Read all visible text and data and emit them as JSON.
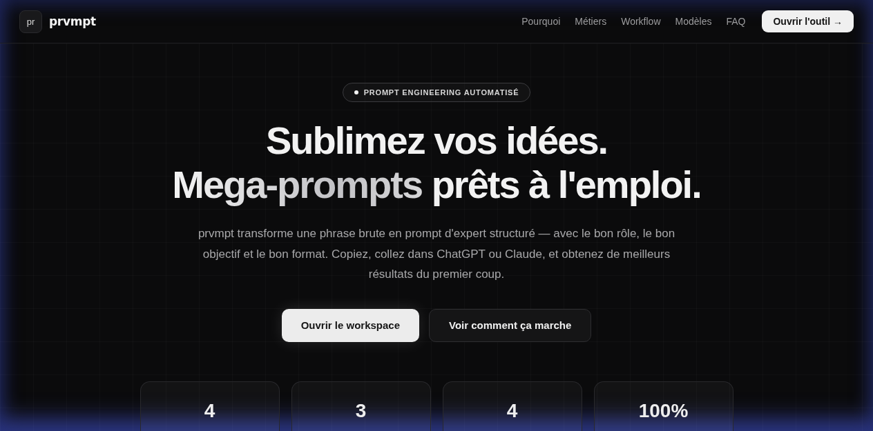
{
  "header": {
    "logo": {
      "mark": "pr",
      "wordmark": "prvmpt"
    },
    "nav": [
      {
        "label": "Pourquoi"
      },
      {
        "label": "Métiers"
      },
      {
        "label": "Workflow"
      },
      {
        "label": "Modèles"
      },
      {
        "label": "FAQ"
      }
    ],
    "cta": "Ouvrir l'outil →"
  },
  "hero": {
    "badge": "PROMPT ENGINEERING AUTOMATISÉ",
    "heading": {
      "line_1": "Sublimez vos idées.",
      "line_2_highlight": "Mega-prompts",
      "line_2_rest": "prêts à l'emploi."
    },
    "description": "prvmpt transforme une phrase brute en prompt d'expert structuré — avec le bon rôle, le bon objectif et le bon format. Copiez, collez dans ChatGPT ou Claude, et obtenez de meilleurs résultats du premier coup.",
    "buttons": [
      {
        "label": "Ouvrir le workspace",
        "kind": "primary"
      },
      {
        "label": "Voir comment ça marche",
        "kind": "secondary"
      }
    ]
  },
  "stats": [
    {
      "value": "4"
    },
    {
      "value": "3"
    },
    {
      "value": "4"
    },
    {
      "value": "100%"
    }
  ]
}
